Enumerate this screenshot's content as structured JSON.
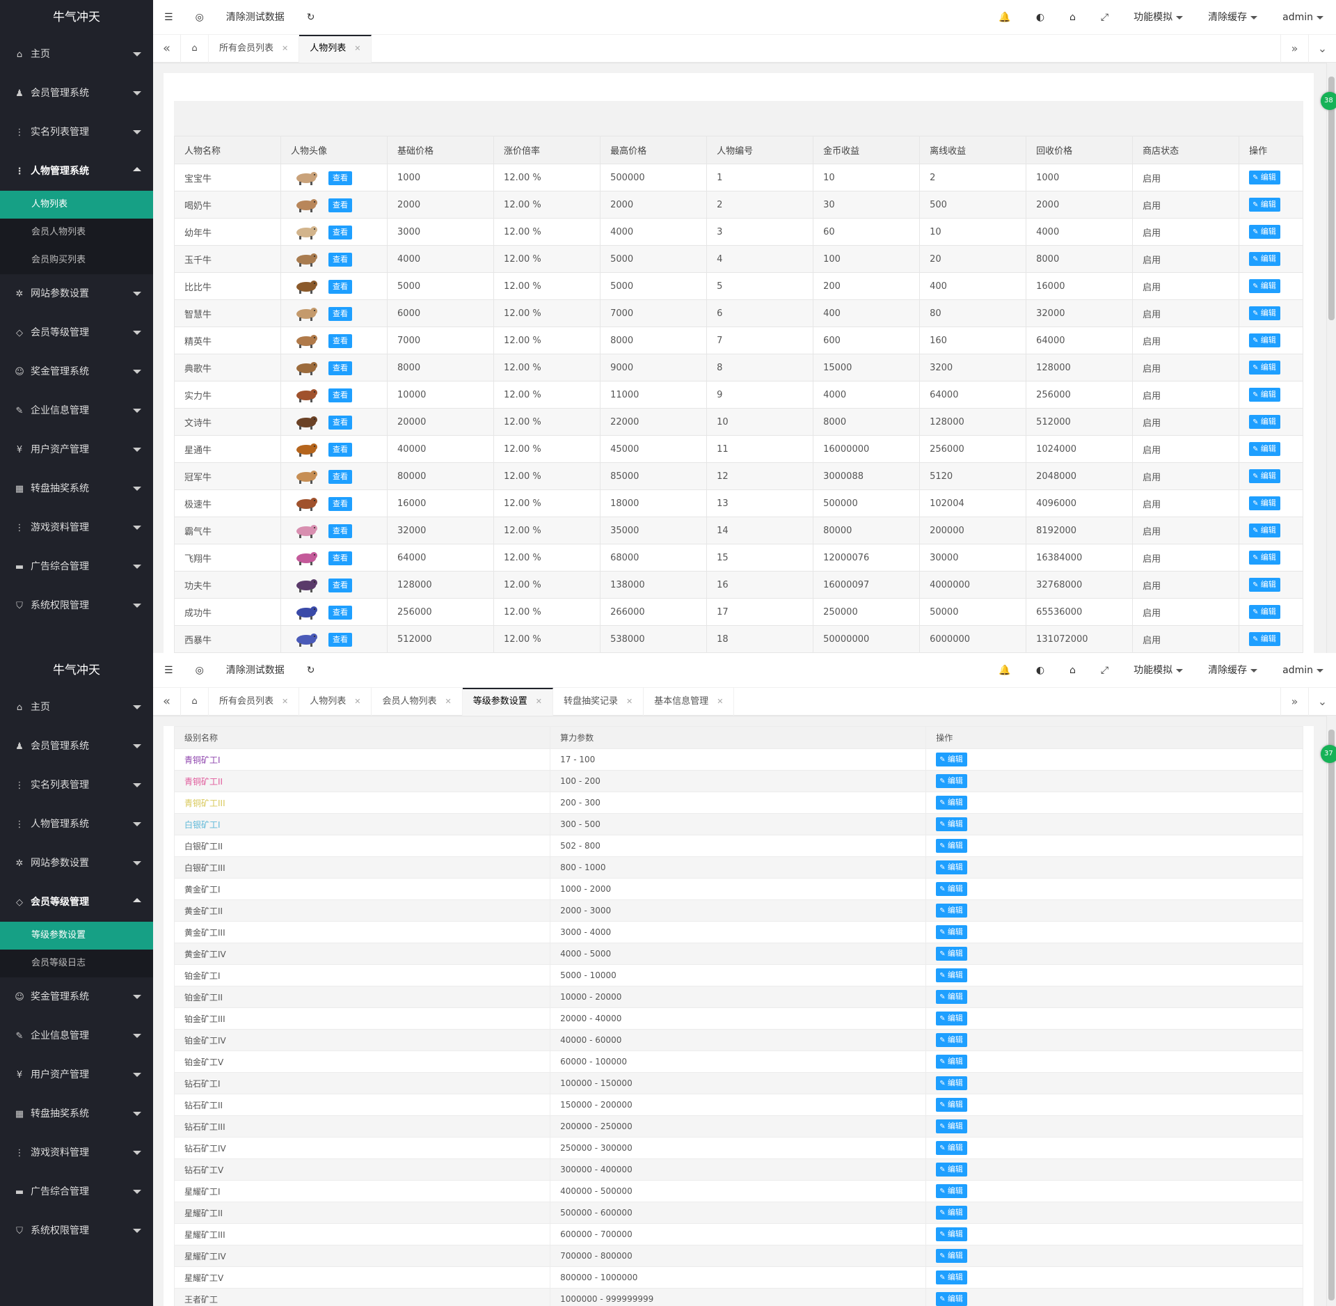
{
  "app_title": "牛气冲天",
  "toolbar": {
    "menu_icon": "menu-fold-icon",
    "globe_icon": "globe-icon",
    "clear_test_data": "清除测试数据",
    "refresh_icon": "refresh-icon",
    "func_sim": "功能模拟",
    "clear_cache": "清除缓存",
    "user": "admin"
  },
  "sidebar_top": [
    {
      "label": "主页",
      "icon": "home-icon"
    },
    {
      "label": "会员管理系统",
      "icon": "users-icon"
    },
    {
      "label": "实名列表管理",
      "icon": "dots-icon"
    },
    {
      "label": "人物管理系统",
      "icon": "dots-icon"
    },
    {
      "label": "网站参数设置",
      "icon": "gear-icon"
    },
    {
      "label": "会员等级管理",
      "icon": "diamond-icon"
    },
    {
      "label": "奖金管理系统",
      "icon": "smile-icon"
    },
    {
      "label": "企业信息管理",
      "icon": "edit-icon"
    },
    {
      "label": "用户资产管理",
      "icon": "yen-icon"
    },
    {
      "label": "转盘抽奖系统",
      "icon": "grid-icon"
    },
    {
      "label": "游戏资料管理",
      "icon": "dots-icon"
    },
    {
      "label": "广告综合管理",
      "icon": "ad-icon"
    },
    {
      "label": "系统权限管理",
      "icon": "shield-icon"
    }
  ],
  "sub_person": [
    "人物列表",
    "会员人物列表",
    "会员购买列表"
  ],
  "sub_level": [
    "等级参数设置",
    "会员等级日志"
  ],
  "screen1_tabs": [
    "所有会员列表",
    "人物列表"
  ],
  "screen2_tabs": [
    "所有会员列表",
    "人物列表",
    "会员人物列表",
    "等级参数设置",
    "转盘抽奖记录",
    "基本信息管理"
  ],
  "badges": {
    "s1": "38",
    "s2": "37"
  },
  "person_table": {
    "headers": [
      "人物名称",
      "人物头像",
      "基础价格",
      "涨价倍率",
      "最高价格",
      "人物编号",
      "金币收益",
      "离线收益",
      "回收价格",
      "商店状态",
      "操作"
    ],
    "view_label": "查看",
    "edit_label": "编辑",
    "rows": [
      [
        "宝宝牛",
        "1000",
        "12.00 %",
        "500000",
        "1",
        "10",
        "2",
        "1000",
        "启用"
      ],
      [
        "喝奶牛",
        "2000",
        "12.00 %",
        "2000",
        "2",
        "30",
        "500",
        "2000",
        "启用"
      ],
      [
        "幼年牛",
        "3000",
        "12.00 %",
        "4000",
        "3",
        "60",
        "10",
        "4000",
        "启用"
      ],
      [
        "玉千牛",
        "4000",
        "12.00 %",
        "5000",
        "4",
        "100",
        "20",
        "8000",
        "启用"
      ],
      [
        "比比牛",
        "5000",
        "12.00 %",
        "5000",
        "5",
        "200",
        "400",
        "16000",
        "启用"
      ],
      [
        "智慧牛",
        "6000",
        "12.00 %",
        "7000",
        "6",
        "400",
        "80",
        "32000",
        "启用"
      ],
      [
        "精英牛",
        "7000",
        "12.00 %",
        "8000",
        "7",
        "600",
        "160",
        "64000",
        "启用"
      ],
      [
        "典歌牛",
        "8000",
        "12.00 %",
        "9000",
        "8",
        "15000",
        "3200",
        "128000",
        "启用"
      ],
      [
        "实力牛",
        "10000",
        "12.00 %",
        "11000",
        "9",
        "4000",
        "64000",
        "256000",
        "启用"
      ],
      [
        "文诗牛",
        "20000",
        "12.00 %",
        "22000",
        "10",
        "8000",
        "128000",
        "512000",
        "启用"
      ],
      [
        "星通牛",
        "40000",
        "12.00 %",
        "45000",
        "11",
        "16000000",
        "256000",
        "1024000",
        "启用"
      ],
      [
        "冠军牛",
        "80000",
        "12.00 %",
        "85000",
        "12",
        "3000088",
        "5120",
        "2048000",
        "启用"
      ],
      [
        "极速牛",
        "16000",
        "12.00 %",
        "18000",
        "13",
        "500000",
        "102004",
        "4096000",
        "启用"
      ],
      [
        "霸气牛",
        "32000",
        "12.00 %",
        "35000",
        "14",
        "80000",
        "200000",
        "8192000",
        "启用"
      ],
      [
        "飞翔牛",
        "64000",
        "12.00 %",
        "68000",
        "15",
        "12000076",
        "30000",
        "16384000",
        "启用"
      ],
      [
        "功夫牛",
        "128000",
        "12.00 %",
        "138000",
        "16",
        "16000097",
        "4000000",
        "32768000",
        "启用"
      ],
      [
        "成功牛",
        "256000",
        "12.00 %",
        "266000",
        "17",
        "250000",
        "50000",
        "65536000",
        "启用"
      ],
      [
        "西暴牛",
        "512000",
        "12.00 %",
        "538000",
        "18",
        "50000000",
        "6000000",
        "131072000",
        "启用"
      ]
    ]
  },
  "level_table": {
    "headers": [
      "级别名称",
      "算力参数",
      "操作"
    ],
    "edit_label": "编辑",
    "rows": [
      {
        "name": "青铜矿工I",
        "range": "17 - 100",
        "color": "#8e44ad"
      },
      {
        "name": "青铜矿工II",
        "range": "100 - 200",
        "color": "#e05a9b"
      },
      {
        "name": "青铜矿工III",
        "range": "200 - 300",
        "color": "#d8c85a"
      },
      {
        "name": "白银矿工I",
        "range": "300 - 500",
        "color": "#5fb8d8"
      },
      {
        "name": "白银矿工II",
        "range": "502 - 800",
        "color": "#555555"
      },
      {
        "name": "白银矿工III",
        "range": "800 - 1000",
        "color": "#555555"
      },
      {
        "name": "黄金矿工I",
        "range": "1000 - 2000",
        "color": "#555555"
      },
      {
        "name": "黄金矿工II",
        "range": "2000 - 3000",
        "color": "#555555"
      },
      {
        "name": "黄金矿工III",
        "range": "3000 - 4000",
        "color": "#555555"
      },
      {
        "name": "黄金矿工IV",
        "range": "4000 - 5000",
        "color": "#555555"
      },
      {
        "name": "铂金矿工I",
        "range": "5000 - 10000",
        "color": "#555555"
      },
      {
        "name": "铂金矿工II",
        "range": "10000 - 20000",
        "color": "#555555"
      },
      {
        "name": "铂金矿工III",
        "range": "20000 - 40000",
        "color": "#555555"
      },
      {
        "name": "铂金矿工IV",
        "range": "40000 - 60000",
        "color": "#555555"
      },
      {
        "name": "铂金矿工V",
        "range": "60000 - 100000",
        "color": "#555555"
      },
      {
        "name": "钻石矿工I",
        "range": "100000 - 150000",
        "color": "#555555"
      },
      {
        "name": "钻石矿工II",
        "range": "150000 - 200000",
        "color": "#555555"
      },
      {
        "name": "钻石矿工III",
        "range": "200000 - 250000",
        "color": "#555555"
      },
      {
        "name": "钻石矿工IV",
        "range": "250000 - 300000",
        "color": "#555555"
      },
      {
        "name": "钻石矿工V",
        "range": "300000 - 400000",
        "color": "#555555"
      },
      {
        "name": "星耀矿工I",
        "range": "400000 - 500000",
        "color": "#555555"
      },
      {
        "name": "星耀矿工II",
        "range": "500000 - 600000",
        "color": "#555555"
      },
      {
        "name": "星耀矿工III",
        "range": "600000 - 700000",
        "color": "#555555"
      },
      {
        "name": "星耀矿工IV",
        "range": "700000 - 800000",
        "color": "#555555"
      },
      {
        "name": "星耀矿工V",
        "range": "800000 - 1000000",
        "color": "#555555"
      },
      {
        "name": "王者矿工",
        "range": "1000000 - 999999999",
        "color": "#555555"
      }
    ]
  }
}
